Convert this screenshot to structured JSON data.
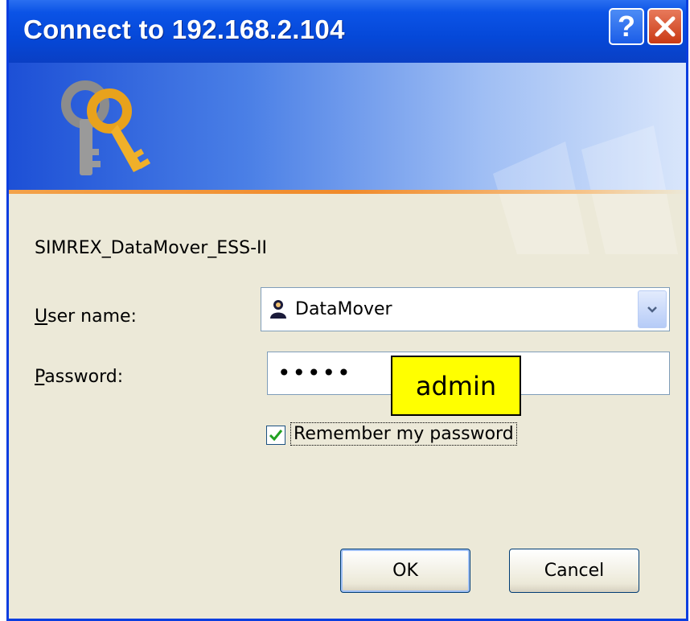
{
  "window": {
    "title": "Connect to 192.168.2.104",
    "help_label": "?"
  },
  "realm": "SIMREX_DataMover_ESS-II",
  "user_name": {
    "label_first": "U",
    "label_rest": "ser name:",
    "value": "DataMover"
  },
  "password": {
    "label_first": "P",
    "label_rest": "assword:",
    "masked_value": "•••••",
    "annotation": "admin"
  },
  "remember": {
    "label_first": "R",
    "label_rest": "emember my password",
    "checked": true
  },
  "buttons": {
    "ok": "OK",
    "cancel": "Cancel"
  },
  "colors": {
    "titlebar": "#0548d8",
    "dialog_bg": "#ece9d8",
    "callout_bg": "#ffff00",
    "close_button": "#c93a14"
  }
}
